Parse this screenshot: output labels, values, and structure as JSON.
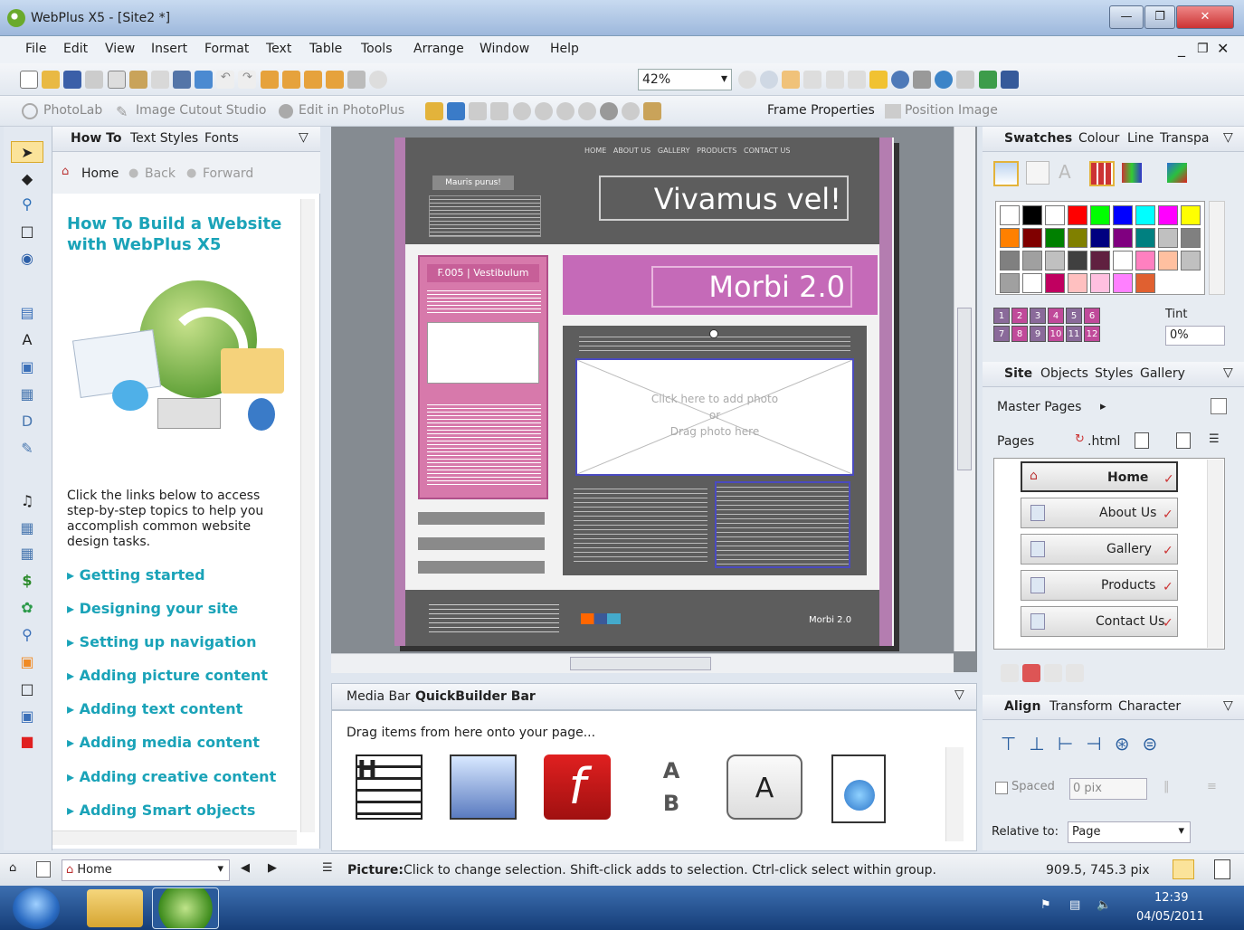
{
  "window": {
    "title": "WebPlus X5 - [Site2 *]"
  },
  "menu": [
    "File",
    "Edit",
    "View",
    "Insert",
    "Format",
    "Text",
    "Table",
    "Tools",
    "Arrange",
    "Window",
    "Help"
  ],
  "toolbar": {
    "zoom": "42%"
  },
  "context_toolbar": {
    "photolab": "PhotoLab",
    "cutout": "Image Cutout Studio",
    "edit_photoplus": "Edit in PhotoPlus",
    "frame_properties": "Frame Properties",
    "position_image": "Position Image"
  },
  "howto": {
    "tabs": [
      "How To",
      "Text Styles",
      "Fonts"
    ],
    "nav": {
      "home": "Home",
      "back": "Back",
      "forward": "Forward"
    },
    "title": "How To Build a Website with WebPlus X5",
    "intro": "Click the links below to access step-by-step topics to help you accomplish common website design tasks.",
    "links": [
      "Getting started",
      "Designing your site",
      "Setting up navigation",
      "Adding picture content",
      "Adding text content",
      "Adding media content",
      "Adding creative content",
      "Adding Smart objects"
    ]
  },
  "page_canvas": {
    "nav_items": [
      "HOME",
      "ABOUT US",
      "GALLERY",
      "PRODUCTS",
      "CONTACT US"
    ],
    "header_title": "Vivamus vel!",
    "side_box_title": "Mauris purus!",
    "pink_header": "F.005 | Vestibulum",
    "morbi": "Morbi 2.0",
    "photo_hint_1": "Click here to add photo",
    "photo_hint_2": "or",
    "photo_hint_3": "Drag photo here",
    "footer_morbi": "Morbi 2.0"
  },
  "quickbuilder": {
    "tabs": [
      "Media Bar",
      "QuickBuilder Bar"
    ],
    "hint": "Drag items from here onto your page..."
  },
  "swatches": {
    "tabs": [
      "Swatches",
      "Colour",
      "Line",
      "Transpa"
    ],
    "tint_label": "Tint",
    "tint_value": "0%",
    "colors": [
      "#ffffff",
      "#000000",
      "#ffffff",
      "#ff0000",
      "#00ff00",
      "#0000ff",
      "#00ffff",
      "#ff00ff",
      "#ffff00",
      "#ff8000",
      "#800000",
      "#008000",
      "#808000",
      "#000080",
      "#800080",
      "#008080",
      "#c0c0c0",
      "#808080",
      "#808080",
      "#a0a0a0",
      "#c0c0c0",
      "#404040",
      "#602040",
      "#ffffff",
      "#ff80c0",
      "#ffc0a0",
      "#c0c0c0",
      "#a0a0a0",
      "#ffffff",
      "#c00060",
      "#ffc0c0",
      "#ffc0e0",
      "#ff80ff",
      "#e06030"
    ],
    "numbers": [
      "1",
      "2",
      "3",
      "4",
      "5",
      "6",
      "7",
      "8",
      "9",
      "10",
      "11",
      "12"
    ]
  },
  "site_panel": {
    "tabs": [
      "Site",
      "Objects",
      "Styles",
      "Gallery"
    ],
    "master_pages": "Master Pages",
    "pages_label": "Pages",
    "html_label": ".html",
    "pages": [
      "Home",
      "About Us",
      "Gallery",
      "Products",
      "Contact Us"
    ]
  },
  "align_panel": {
    "tabs": [
      "Align",
      "Transform",
      "Character"
    ],
    "spaced": "Spaced",
    "spaced_value": "0 pix",
    "relative_label": "Relative to:",
    "relative_value": "Page"
  },
  "statusbar": {
    "page": "Home",
    "message_bold": "Picture:",
    "message": "Click to change selection. Shift-click adds to selection. Ctrl-click select within group.",
    "coords": "909.5, 745.3 pix"
  },
  "taskbar": {
    "time": "12:39",
    "date": "04/05/2011"
  }
}
